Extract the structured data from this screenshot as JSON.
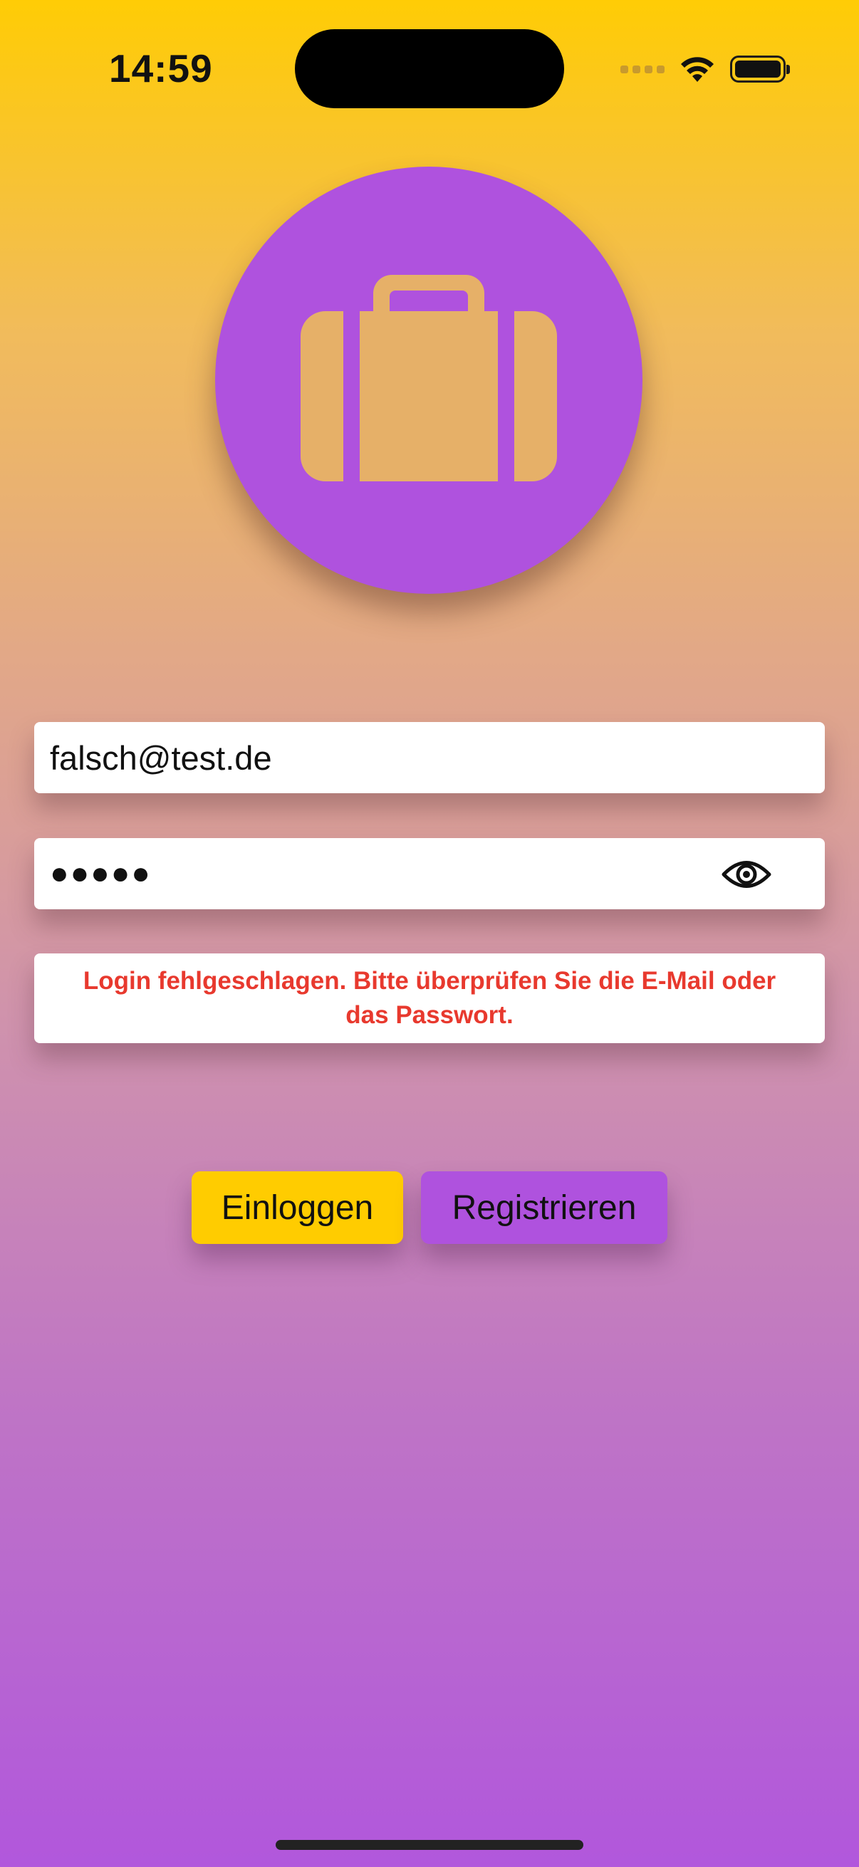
{
  "status_bar": {
    "time": "14:59"
  },
  "logo": {
    "icon": "suitcase-icon",
    "circle_color": "#af52de"
  },
  "login_form": {
    "email_value": "falsch@test.de",
    "password_masked": "●●●●●",
    "password_visibility_icon": "eye-icon",
    "error_message": "Login fehlgeschlagen. Bitte überprüfen Sie die E-Mail oder das Passwort.",
    "error_color": "#e8392e"
  },
  "buttons": {
    "login_label": "Einloggen",
    "login_color": "#ffcc00",
    "register_label": "Registrieren",
    "register_color": "#af52de"
  }
}
